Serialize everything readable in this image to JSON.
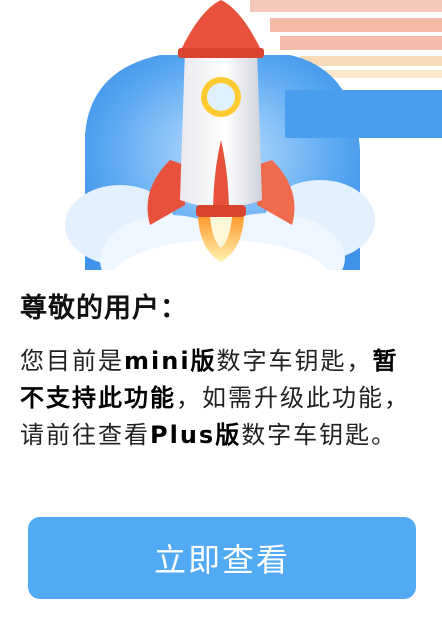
{
  "dialog": {
    "title": "尊敬的用户：",
    "message": {
      "p1": "您目前是",
      "b1": "mini版",
      "p2": "数字车钥匙，",
      "b2": "暂不支持此功能",
      "p3": "，如需升级此功能，请前往查看",
      "b3": "Plus版",
      "p4": "数字车钥匙。"
    },
    "cta_label": "立即查看"
  },
  "icons": {
    "hero": "rocket-launch-icon"
  },
  "colors": {
    "accent": "#52a9f4",
    "sky": "#4a9ef0",
    "rocket_red": "#e8513c",
    "flame": "#ffc930"
  }
}
